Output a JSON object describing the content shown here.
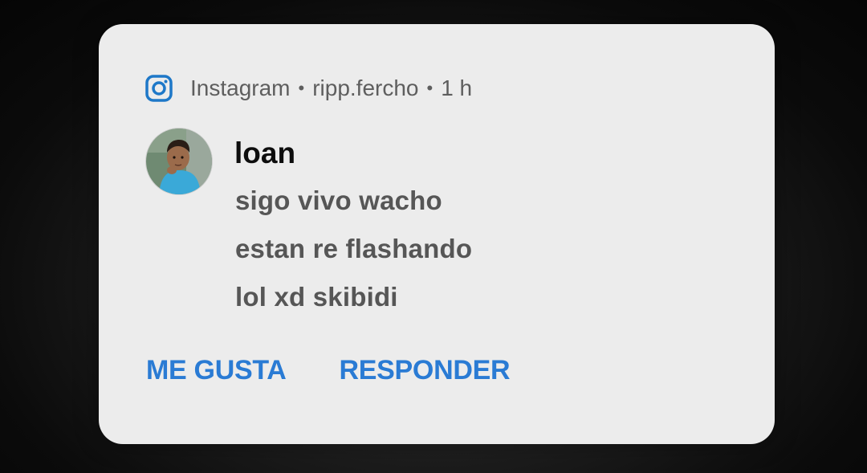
{
  "notification": {
    "app_icon": "instagram-icon",
    "app_name": "Instagram",
    "account": "ripp.fercho",
    "time": "1 h",
    "separator": "•",
    "sender": "loan",
    "avatar": "user-avatar-photo",
    "messages": [
      "sigo vivo wacho",
      "estan re flashando",
      "lol xd skibidi"
    ],
    "actions": {
      "like_label": "ME GUSTA",
      "reply_label": "RESPONDER"
    },
    "colors": {
      "accent": "#2a7bd4",
      "card_bg": "#ececec",
      "icon": "#1e78c8"
    }
  }
}
